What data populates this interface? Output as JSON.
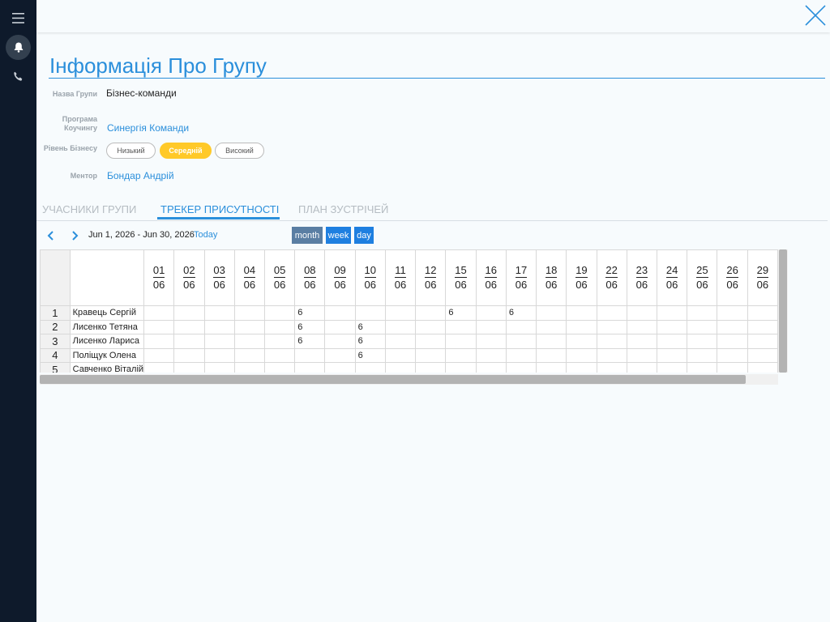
{
  "sidebar": {
    "items": [
      {
        "icon": "menu-icon"
      },
      {
        "icon": "bell-icon"
      },
      {
        "icon": "phone-icon"
      }
    ]
  },
  "header": {
    "close_icon": "close-icon"
  },
  "page": {
    "title": "Інформація Про Групу"
  },
  "details": {
    "group_name_label": "Назва Групи",
    "group_name": "Бізнес-команди",
    "program_label_line1": "Програма",
    "program_label_line2": "Коучингу",
    "program": "Синергія Команди",
    "level_label": "Рівень Бізнесу",
    "levels": [
      "Низький",
      "Середній",
      "Високий"
    ],
    "selected_level": "Середній",
    "mentor_label": "Ментор",
    "mentor": "Бондар Андрій"
  },
  "tabs": [
    {
      "label": "УЧАСНИКИ ГРУПИ",
      "active": false
    },
    {
      "label": "ТРЕКЕР ПРИСУТНОСТІ",
      "active": true
    },
    {
      "label": "ПЛАН ЗУСТРІЧЕЙ",
      "active": false
    }
  ],
  "calendar": {
    "range": "Jun 1, 2026 - Jun 30, 2026",
    "today_label": "Today",
    "views": [
      "month",
      "week",
      "day"
    ],
    "days": [
      "01",
      "02",
      "03",
      "04",
      "05",
      "08",
      "09",
      "10",
      "11",
      "12",
      "15",
      "16",
      "17",
      "18",
      "19",
      "22",
      "23",
      "24",
      "25",
      "26",
      "29"
    ],
    "month": "06",
    "rows": [
      {
        "num": "1",
        "name": "Кравець Сергій",
        "cells": [
          "",
          "",
          "",
          "",
          "",
          "6",
          "",
          "",
          "",
          "",
          "6",
          "",
          "6",
          "",
          "",
          "",
          "",
          "",
          "",
          "",
          ""
        ]
      },
      {
        "num": "2",
        "name": "Лисенко  Тетяна",
        "cells": [
          "",
          "",
          "",
          "",
          "",
          "6",
          "",
          "6",
          "",
          "",
          "",
          "",
          "",
          "",
          "",
          "",
          "",
          "",
          "",
          "",
          ""
        ]
      },
      {
        "num": "3",
        "name": "Лисенко Лариса",
        "cells": [
          "",
          "",
          "",
          "",
          "",
          "6",
          "",
          "6",
          "",
          "",
          "",
          "",
          "",
          "",
          "",
          "",
          "",
          "",
          "",
          "",
          ""
        ]
      },
      {
        "num": "4",
        "name": "Поліщук Олена",
        "cells": [
          "",
          "",
          "",
          "",
          "",
          "",
          "",
          "6",
          "",
          "",
          "",
          "",
          "",
          "",
          "",
          "",
          "",
          "",
          "",
          "",
          ""
        ]
      },
      {
        "num": "5",
        "name": "Савченко Віталій",
        "cells": [
          "",
          "",
          "",
          "",
          "",
          "",
          "",
          "",
          "",
          "",
          "",
          "",
          "",
          "",
          "",
          "",
          "",
          "",
          "",
          "",
          ""
        ]
      }
    ]
  },
  "colors": {
    "accent": "#2b8fdb",
    "selected_pill": "#ffc928",
    "sidebar": "#0e1a2b",
    "month_button": "#5a7ea3",
    "view_button": "#1e7fe0"
  }
}
